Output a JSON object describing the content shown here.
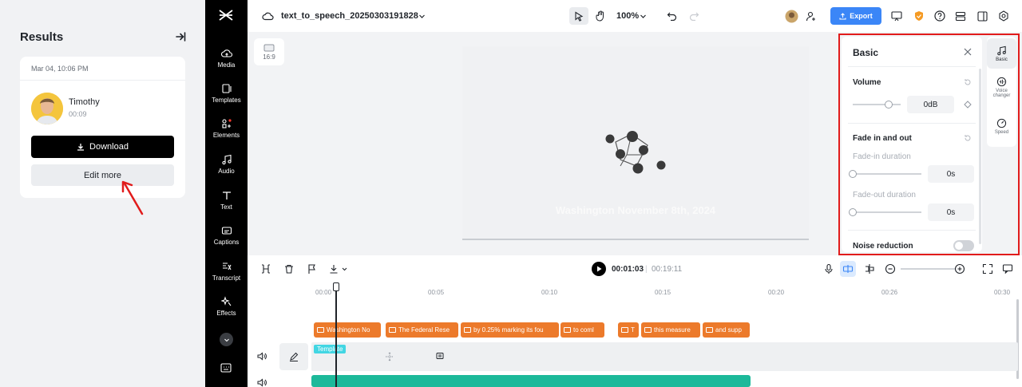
{
  "results": {
    "title": "Results",
    "card": {
      "date": "Mar 04, 10:06 PM",
      "name": "Timothy",
      "duration": "00:09",
      "download_label": "Download",
      "edit_label": "Edit more"
    }
  },
  "sidebar": {
    "items": [
      {
        "label": "Media",
        "icon": "cloud-upload-icon"
      },
      {
        "label": "Templates",
        "icon": "templates-icon"
      },
      {
        "label": "Elements",
        "icon": "elements-icon"
      },
      {
        "label": "Audio",
        "icon": "music-note-icon"
      },
      {
        "label": "Text",
        "icon": "text-icon"
      },
      {
        "label": "Captions",
        "icon": "captions-icon"
      },
      {
        "label": "Transcript",
        "icon": "transcript-icon"
      },
      {
        "label": "Effects",
        "icon": "effects-icon"
      }
    ]
  },
  "topbar": {
    "project_title": "text_to_speech_20250303191828",
    "zoom": "100%",
    "export_label": "Export"
  },
  "canvas": {
    "ratio_label": "16:9",
    "caption": "Washington November 8th, 2024"
  },
  "props": {
    "title": "Basic",
    "volume_label": "Volume",
    "volume_value": "0dB",
    "fade_label": "Fade in and out",
    "fade_in_label": "Fade-in duration",
    "fade_in_value": "0s",
    "fade_out_label": "Fade-out duration",
    "fade_out_value": "0s",
    "noise_label": "Noise reduction",
    "noise_on": false
  },
  "right_tabs": [
    {
      "label": "Basic",
      "icon": "music-note-icon"
    },
    {
      "label": "Voice changer",
      "icon": "voice-changer-icon"
    },
    {
      "label": "Speed",
      "icon": "speed-icon"
    }
  ],
  "timeline": {
    "current_time": "00:01:03",
    "total_time": "00:19:11",
    "ruler_ticks": [
      "00:00",
      "00:05",
      "00:10",
      "00:15",
      "00:20",
      "00:26",
      "00:30"
    ],
    "clips": [
      {
        "label": "Washington No"
      },
      {
        "label": "The Federal Rese"
      },
      {
        "label": "by 0.25% marking its fou"
      },
      {
        "label": "to coml"
      },
      {
        "label": "T"
      },
      {
        "label": "this measure"
      },
      {
        "label": "and supp"
      }
    ],
    "template_label": "Template"
  },
  "colors": {
    "accent": "#3b86f7",
    "clip": "#ec7a2b",
    "highlight": "#e11b1b",
    "template": "#42d6e3",
    "audio": "#1cb99a"
  }
}
